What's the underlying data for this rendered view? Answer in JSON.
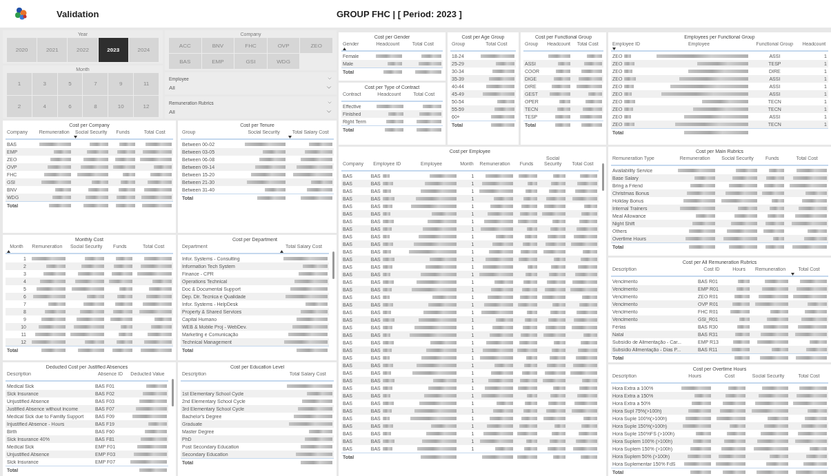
{
  "header": {
    "title": "Validation",
    "report_title": "GROUP FHC | [ Period: 2023 ]"
  },
  "year_slicer": {
    "title": "Year",
    "options": [
      {
        "label": "2020",
        "selected": false
      },
      {
        "label": "2021",
        "selected": false
      },
      {
        "label": "2022",
        "selected": false
      },
      {
        "label": "2023",
        "selected": true
      },
      {
        "label": "2024",
        "selected": false
      }
    ]
  },
  "month_slicer": {
    "title": "Month",
    "options": [
      {
        "label": "1",
        "selected": false
      },
      {
        "label": "3",
        "selected": false
      },
      {
        "label": "5",
        "selected": false
      },
      {
        "label": "7",
        "selected": false
      },
      {
        "label": "9",
        "selected": false
      },
      {
        "label": "11",
        "selected": false
      },
      {
        "label": "2",
        "selected": false
      },
      {
        "label": "4",
        "selected": false
      },
      {
        "label": "6",
        "selected": false
      },
      {
        "label": "8",
        "selected": false
      },
      {
        "label": "10",
        "selected": false
      },
      {
        "label": "12",
        "selected": false
      }
    ]
  },
  "company_slicer": {
    "title": "Company",
    "options": [
      {
        "label": "ACC",
        "selected": false
      },
      {
        "label": "BNV",
        "selected": false
      },
      {
        "label": "FHC",
        "selected": false
      },
      {
        "label": "OVP",
        "selected": false
      },
      {
        "label": "ZEO",
        "selected": false
      },
      {
        "label": "BAS",
        "selected": false
      },
      {
        "label": "EMP",
        "selected": false
      },
      {
        "label": "GSI",
        "selected": false
      },
      {
        "label": "WDG",
        "selected": false
      }
    ]
  },
  "dropdowns": [
    {
      "label": "Employee",
      "value": "All"
    },
    {
      "label": "Remuneration Rubrics",
      "value": "All"
    }
  ],
  "cost_per_company": {
    "title": "Cost per Company",
    "columns": [
      {
        "label": "Company",
        "kind": "label",
        "sorted": false
      },
      {
        "label": "Remuneration",
        "kind": "redacted",
        "sorted": false
      },
      {
        "label": "Social Security",
        "kind": "redacted",
        "sorted": true,
        "ascending": false
      },
      {
        "label": "Funds",
        "kind": "redacted",
        "sorted": false
      },
      {
        "label": "Total Cost",
        "kind": "redacted",
        "sorted": false
      }
    ],
    "rows": [
      [
        "BAS",
        "",
        "",
        "",
        ""
      ],
      [
        "EMP",
        "",
        "",
        "",
        ""
      ],
      [
        "ZEO",
        "",
        "",
        "",
        ""
      ],
      [
        "OVP",
        "",
        "",
        "",
        ""
      ],
      [
        "FHC",
        "",
        "",
        "",
        ""
      ],
      [
        "GSI",
        "",
        "",
        "",
        ""
      ],
      [
        "BNV",
        "",
        "",
        "",
        ""
      ],
      [
        "WDG",
        "",
        "",
        "",
        ""
      ]
    ],
    "total": "Total"
  },
  "cost_per_tenure": {
    "title": "Cost per Tenure",
    "columns": [
      {
        "label": "Group",
        "kind": "label",
        "sorted": false
      },
      {
        "label": "Social Security",
        "kind": "redacted",
        "sorted": false
      },
      {
        "label": "Total Salary Cost",
        "kind": "redacted",
        "sorted": true,
        "ascending": false
      }
    ],
    "rows": [
      [
        "Between 00-02",
        "",
        ""
      ],
      [
        "Between 03-05",
        "",
        ""
      ],
      [
        "Between 06-08",
        "",
        ""
      ],
      [
        "Between 09-14",
        "",
        ""
      ],
      [
        "Between 15-20",
        "",
        ""
      ],
      [
        "Between 21-30",
        "",
        ""
      ],
      [
        "Between 31-40",
        "",
        ""
      ]
    ],
    "total": "Total"
  },
  "monthly_cost": {
    "title": "Monthly Cost",
    "columns": [
      {
        "label": "Month",
        "kind": "number",
        "sorted": true,
        "ascending": true
      },
      {
        "label": "Remuneration",
        "kind": "redacted",
        "sorted": false
      },
      {
        "label": "Social Security",
        "kind": "redacted",
        "sorted": false
      },
      {
        "label": "Funds",
        "kind": "redacted",
        "sorted": false
      },
      {
        "label": "Total Cost",
        "kind": "redacted",
        "sorted": false
      }
    ],
    "rows": [
      [
        "1",
        "",
        "",
        "",
        ""
      ],
      [
        "2",
        "",
        "",
        "",
        ""
      ],
      [
        "3",
        "",
        "",
        "",
        ""
      ],
      [
        "4",
        "",
        "",
        "",
        ""
      ],
      [
        "5",
        "",
        "",
        "",
        ""
      ],
      [
        "6",
        "",
        "",
        "",
        ""
      ],
      [
        "7",
        "",
        "",
        "",
        ""
      ],
      [
        "8",
        "",
        "",
        "",
        ""
      ],
      [
        "9",
        "",
        "",
        "",
        ""
      ],
      [
        "10",
        "",
        "",
        "",
        ""
      ],
      [
        "11",
        "",
        "",
        "",
        ""
      ],
      [
        "12",
        "",
        "",
        "",
        ""
      ]
    ],
    "total": "Total"
  },
  "cost_per_department": {
    "title": "Cost per Department",
    "scrollable": true,
    "columns": [
      {
        "label": "Department",
        "kind": "label",
        "sorted": false
      },
      {
        "label": "Total Salary Cost",
        "kind": "redacted",
        "sorted": true,
        "ascending": true
      }
    ],
    "rows": [
      [
        "Infor. Systems - Consulting",
        ""
      ],
      [
        "Information Tech System",
        ""
      ],
      [
        "Finance - CPR",
        ""
      ],
      [
        "Operations Technical",
        ""
      ],
      [
        "Doc & Documental Support",
        ""
      ],
      [
        "Dep. Dir. Tecnica e Qualidade",
        ""
      ],
      [
        "Infor. Systems - HelpDesk",
        ""
      ],
      [
        "Property & Shared Services",
        ""
      ],
      [
        "Capital Humano",
        ""
      ],
      [
        "WEB & Mobile Proj - WebDev.",
        ""
      ],
      [
        "Marketing e Comunicação",
        ""
      ],
      [
        "Technical  Management",
        ""
      ]
    ],
    "total": "Total"
  },
  "deducted_cost_per_justified_absences": {
    "title": "Deducted Cost per Justified Absences",
    "scrollable": true,
    "columns": [
      {
        "label": "Description",
        "kind": "label",
        "sorted": false
      },
      {
        "label": "Absence ID",
        "kind": "label",
        "sorted": false
      },
      {
        "label": "Deducted Value",
        "kind": "redacted",
        "sorted": false
      }
    ],
    "rows": [
      [
        "Medical Sick",
        "BAS F01",
        ""
      ],
      [
        "Sick Insurance",
        "BAS F02",
        ""
      ],
      [
        "Unjustified Absence",
        "BAS F03",
        ""
      ],
      [
        "Justified Absence without income",
        "BAS F07",
        ""
      ],
      [
        "Medical Sick due to Familly Support",
        "BAS F09",
        ""
      ],
      [
        "Injustified Absence - Hours",
        "BAS F19",
        ""
      ],
      [
        "Birth",
        "BAS F60",
        ""
      ],
      [
        "Sick Insurance 40%",
        "BAS F81",
        ""
      ],
      [
        "Medical Sick",
        "EMP F01",
        ""
      ],
      [
        "Unjustified Absence",
        "EMP F03",
        ""
      ],
      [
        "Sick Insurance",
        "EMP F07",
        ""
      ]
    ],
    "total": "Total"
  },
  "cost_per_education_level": {
    "title": "Cost per Education Level",
    "columns": [
      {
        "label": "Description",
        "kind": "label",
        "sorted": false
      },
      {
        "label": "Total Salary Cost",
        "kind": "redacted",
        "sorted": false
      }
    ],
    "rows": [
      [
        "",
        ""
      ],
      [
        "1st Elementary School Cycle",
        ""
      ],
      [
        "2nd Elementary School Cycle",
        ""
      ],
      [
        "3rd Elementary School Cycle",
        ""
      ],
      [
        "Bachelor's Degree",
        ""
      ],
      [
        "Graduate",
        ""
      ],
      [
        "Master Degree",
        ""
      ],
      [
        "PhD",
        ""
      ],
      [
        "Post Secondary Education",
        ""
      ],
      [
        "Secondary Education",
        ""
      ]
    ],
    "total": "Total"
  },
  "cost_per_gender": {
    "title": "Cost per Gender",
    "columns": [
      {
        "label": "Gender",
        "kind": "label",
        "sorted": true,
        "ascending": true
      },
      {
        "label": "Headcount",
        "kind": "redacted",
        "sorted": false
      },
      {
        "label": "Total Cost",
        "kind": "redacted",
        "sorted": false
      }
    ],
    "rows": [
      [
        "Female",
        "",
        ""
      ],
      [
        "Male",
        "",
        ""
      ]
    ],
    "total": "Total"
  },
  "cost_per_type_of_contract": {
    "title": "Cost per Type of Contract",
    "columns": [
      {
        "label": "Contract",
        "kind": "label",
        "sorted": false
      },
      {
        "label": "Headcount",
        "kind": "redacted",
        "sorted": false
      },
      {
        "label": "Total Cost",
        "kind": "redacted",
        "sorted": false
      }
    ],
    "rows": [
      [
        "Effective",
        "",
        ""
      ],
      [
        "Finished",
        "",
        ""
      ],
      [
        "Right Term",
        "",
        ""
      ]
    ],
    "total": "Total"
  },
  "cost_per_age_group": {
    "title": "Cost per Age Group",
    "columns": [
      {
        "label": "Group",
        "kind": "label",
        "sorted": false
      },
      {
        "label": "Total Cost",
        "kind": "redacted",
        "sorted": false
      }
    ],
    "rows": [
      [
        "18-24",
        ""
      ],
      [
        "25-29",
        ""
      ],
      [
        "30-34",
        ""
      ],
      [
        "35-39",
        ""
      ],
      [
        "40-44",
        ""
      ],
      [
        "45-49",
        ""
      ],
      [
        "50-54",
        ""
      ],
      [
        "55-59",
        ""
      ],
      [
        "60+",
        ""
      ]
    ],
    "total": "Total"
  },
  "cost_per_functional_group": {
    "title": "Cost per Functional Group",
    "columns": [
      {
        "label": "Group",
        "kind": "label",
        "sorted": false
      },
      {
        "label": "Headcount",
        "kind": "redacted",
        "sorted": false
      },
      {
        "label": "Total Cost",
        "kind": "redacted",
        "sorted": false
      }
    ],
    "rows": [
      [
        "",
        "",
        ""
      ],
      [
        "ASSI",
        "",
        ""
      ],
      [
        "COOR",
        "",
        ""
      ],
      [
        "DIGE",
        "",
        ""
      ],
      [
        "DIRE",
        "",
        ""
      ],
      [
        "GEST",
        "",
        ""
      ],
      [
        "OPER",
        "",
        ""
      ],
      [
        "TECN",
        "",
        ""
      ],
      [
        "TESP",
        "",
        ""
      ]
    ],
    "total": "Total"
  },
  "cost_per_employee": {
    "title": "Cost per Employee",
    "scrollable": true,
    "columns": [
      {
        "label": "Company",
        "kind": "label",
        "sorted": false
      },
      {
        "label": "Employee ID",
        "kind": "id",
        "sorted": false
      },
      {
        "label": "Employee",
        "kind": "redacted",
        "sorted": false
      },
      {
        "label": "Month",
        "kind": "number",
        "sorted": false
      },
      {
        "label": "Remuneration",
        "kind": "redacted",
        "sorted": false
      },
      {
        "label": "Funds",
        "kind": "redacted",
        "sorted": false
      },
      {
        "label": "Social Security",
        "kind": "redacted",
        "sorted": false
      },
      {
        "label": "Total Cost",
        "kind": "redacted",
        "sorted": false
      }
    ],
    "rows": [
      [
        "BAS",
        "BAS",
        "",
        "1",
        "",
        "",
        "",
        ""
      ],
      [
        "BAS",
        "BAS",
        "",
        "1",
        "",
        "",
        "",
        ""
      ],
      [
        "BAS",
        "BAS",
        "",
        "1",
        "",
        "",
        "",
        ""
      ],
      [
        "BAS",
        "BAS",
        "",
        "1",
        "",
        "",
        "",
        ""
      ],
      [
        "BAS",
        "BAS",
        "",
        "1",
        "",
        "",
        "",
        ""
      ],
      [
        "BAS",
        "BAS",
        "",
        "1",
        "",
        "",
        "",
        ""
      ],
      [
        "BAS",
        "BAS",
        "",
        "1",
        "",
        "",
        "",
        ""
      ],
      [
        "BAS",
        "BAS",
        "",
        "1",
        "",
        "",
        "",
        ""
      ],
      [
        "BAS",
        "BAS",
        "",
        "1",
        "",
        "",
        "",
        ""
      ],
      [
        "BAS",
        "BAS",
        "",
        "1",
        "",
        "",
        "",
        ""
      ],
      [
        "BAS",
        "BAS",
        "",
        "1",
        "",
        "",
        "",
        ""
      ],
      [
        "BAS",
        "BAS",
        "",
        "1",
        "",
        "",
        "",
        ""
      ],
      [
        "BAS",
        "BAS",
        "",
        "1",
        "",
        "",
        "",
        ""
      ],
      [
        "BAS",
        "BAS",
        "",
        "1",
        "",
        "",
        "",
        ""
      ],
      [
        "BAS",
        "BAS",
        "",
        "1",
        "",
        "",
        "",
        ""
      ],
      [
        "BAS",
        "BAS",
        "",
        "1",
        "",
        "",
        "",
        ""
      ],
      [
        "BAS",
        "BAS",
        "",
        "1",
        "",
        "",
        "",
        ""
      ],
      [
        "BAS",
        "BAS",
        "",
        "1",
        "",
        "",
        "",
        ""
      ],
      [
        "BAS",
        "BAS",
        "",
        "1",
        "",
        "",
        "",
        ""
      ],
      [
        "BAS",
        "BAS",
        "",
        "1",
        "",
        "",
        "",
        ""
      ],
      [
        "BAS",
        "BAS",
        "",
        "1",
        "",
        "",
        "",
        ""
      ],
      [
        "BAS",
        "BAS",
        "",
        "1",
        "",
        "",
        "",
        ""
      ],
      [
        "BAS",
        "BAS",
        "",
        "1",
        "",
        "",
        "",
        ""
      ],
      [
        "BAS",
        "BAS",
        "",
        "1",
        "",
        "",
        "",
        ""
      ],
      [
        "BAS",
        "BAS",
        "",
        "1",
        "",
        "",
        "",
        ""
      ],
      [
        "BAS",
        "BAS",
        "",
        "1",
        "",
        "",
        "",
        ""
      ],
      [
        "BAS",
        "BAS",
        "",
        "1",
        "",
        "",
        "",
        ""
      ],
      [
        "BAS",
        "BAS",
        "",
        "1",
        "",
        "",
        "",
        ""
      ],
      [
        "BAS",
        "BAS",
        "",
        "1",
        "",
        "",
        "",
        ""
      ],
      [
        "BAS",
        "BAS",
        "",
        "1",
        "",
        "",
        "",
        ""
      ],
      [
        "BAS",
        "BAS",
        "",
        "1",
        "",
        "",
        "",
        ""
      ],
      [
        "BAS",
        "BAS",
        "",
        "1",
        "",
        "",
        "",
        ""
      ],
      [
        "BAS",
        "BAS",
        "",
        "1",
        "",
        "",
        "",
        ""
      ],
      [
        "BAS",
        "BAS",
        "",
        "1",
        "",
        "",
        "",
        ""
      ],
      [
        "BAS",
        "BAS",
        "",
        "1",
        "",
        "",
        "",
        ""
      ],
      [
        "BAS",
        "BAS",
        "",
        "1",
        "",
        "",
        "",
        ""
      ],
      [
        "BAS",
        "BAS",
        "",
        "1",
        "",
        "",
        "",
        ""
      ]
    ],
    "total": "Total"
  },
  "employees_per_functional_group": {
    "title": "Employees per Functional Group",
    "columns": [
      {
        "label": "Employee ID",
        "kind": "id",
        "sorted": true,
        "ascending": false
      },
      {
        "label": "Employee",
        "kind": "redacted",
        "sorted": false
      },
      {
        "label": "Functional Group",
        "kind": "code",
        "sorted": false
      },
      {
        "label": "Headcount",
        "kind": "number",
        "sorted": false
      }
    ],
    "rows": [
      [
        "ZEO",
        "",
        "ASSI",
        "1"
      ],
      [
        "ZEO",
        "",
        "TESP",
        "1"
      ],
      [
        "ZEO",
        "",
        "DIRE",
        "1"
      ],
      [
        "ZEO",
        "",
        "ASSI",
        "1"
      ],
      [
        "ZEO",
        "",
        "ASSI",
        "1"
      ],
      [
        "ZEO",
        "",
        "ASSI",
        "1"
      ],
      [
        "ZEO",
        "",
        "TECN",
        "1"
      ],
      [
        "ZEO",
        "",
        "TECN",
        "1"
      ],
      [
        "ZEO",
        "",
        "ASSI",
        "1"
      ],
      [
        "ZEO",
        "",
        "TECN",
        "1"
      ]
    ],
    "total": "Total"
  },
  "cost_per_main_rubrics": {
    "title": "Cost per Main Rubrics",
    "columns": [
      {
        "label": "Remuneration Type",
        "kind": "label",
        "sorted": false
      },
      {
        "label": "Remuneration",
        "kind": "redacted",
        "sorted": false
      },
      {
        "label": "Social Security",
        "kind": "redacted",
        "sorted": false
      },
      {
        "label": "Funds",
        "kind": "redacted",
        "sorted": false
      },
      {
        "label": "Total Cost",
        "kind": "redacted",
        "sorted": false
      }
    ],
    "rows": [
      [
        "Availability Service",
        "",
        "",
        "",
        ""
      ],
      [
        "Base Salary",
        "",
        "",
        "",
        ""
      ],
      [
        "Bring a Friend",
        "",
        "",
        "",
        ""
      ],
      [
        "Christmas Bonus",
        "",
        "",
        "",
        ""
      ],
      [
        "Holiday Bonus",
        "",
        "",
        "",
        ""
      ],
      [
        "Internal Trainers",
        "",
        "",
        "",
        ""
      ],
      [
        "Meal Allowance",
        "",
        "",
        "",
        ""
      ],
      [
        "Night Shift",
        "",
        "",
        "",
        ""
      ],
      [
        "Others",
        "",
        "",
        "",
        ""
      ],
      [
        "Overtime Hours",
        "",
        "",
        "",
        ""
      ]
    ],
    "total": "Total"
  },
  "cost_per_all_remuneration_rubrics": {
    "title": "Cost per All Remuneration Rubrics",
    "columns": [
      {
        "label": "Description",
        "kind": "label",
        "sorted": false
      },
      {
        "label": "Cost ID",
        "kind": "label",
        "sorted": false
      },
      {
        "label": "Hours",
        "kind": "redacted",
        "sorted": false
      },
      {
        "label": "Remuneration",
        "kind": "redacted",
        "sorted": false
      },
      {
        "label": "Total Cost",
        "kind": "redacted",
        "sorted": true,
        "ascending": false
      }
    ],
    "rows": [
      [
        "Vencimento",
        "BAS R01",
        "",
        "",
        ""
      ],
      [
        "Vencimento",
        "EMP R01",
        "",
        "",
        ""
      ],
      [
        "Vencimento",
        "ZEO R01",
        "",
        "",
        ""
      ],
      [
        "Vencimento",
        "OVP R01",
        "",
        "",
        ""
      ],
      [
        "Vencimento",
        "FHC R01",
        "",
        "",
        ""
      ],
      [
        "Vencimento",
        "GSI_R01",
        "",
        "",
        ""
      ],
      [
        "Férias",
        "BAS R30",
        "",
        "",
        ""
      ],
      [
        "Natal",
        "BAS R31",
        "",
        "",
        ""
      ],
      [
        "Subsídio de Alimentação - Car...",
        "EMP R13",
        "",
        "",
        ""
      ],
      [
        "Subsídio Alimentação - Dias P...",
        "BAS R11",
        "",
        "",
        ""
      ]
    ],
    "total": "Total"
  },
  "cost_per_overtime_hours": {
    "title": "Cost per Overtime Hours",
    "columns": [
      {
        "label": "Description",
        "kind": "label",
        "sorted": false
      },
      {
        "label": "Hours",
        "kind": "redacted",
        "sorted": false
      },
      {
        "label": "Cost",
        "kind": "redacted",
        "sorted": false
      },
      {
        "label": "Social Security",
        "kind": "redacted",
        "sorted": false
      },
      {
        "label": "Total Cost",
        "kind": "redacted",
        "sorted": false
      }
    ],
    "rows": [
      [
        "Hora Extra a 100%",
        "",
        "",
        "",
        ""
      ],
      [
        "Hora Extra a 150%",
        "",
        "",
        "",
        ""
      ],
      [
        "Hora Extra a 50%",
        "",
        "",
        "",
        ""
      ],
      [
        "Hora Supl 75%(>100h)",
        "",
        "",
        "",
        ""
      ],
      [
        "Hora Suple 100%(>100h)",
        "",
        "",
        "",
        ""
      ],
      [
        "Hora Suple 150%(>100h)",
        "",
        "",
        "",
        ""
      ],
      [
        "Hora Suple 150%FS (>100h)",
        "",
        "",
        "",
        ""
      ],
      [
        "Hora Suplem 100% (>100h)",
        "",
        "",
        "",
        ""
      ],
      [
        "Hora Suplem 150% (>100h)",
        "",
        "",
        "",
        ""
      ],
      [
        "Hora Suplem 50% (>100h)",
        "",
        "",
        "",
        ""
      ],
      [
        "Hora Suplementar 150% FdS",
        "",
        "",
        "",
        ""
      ]
    ],
    "total": "Total"
  }
}
